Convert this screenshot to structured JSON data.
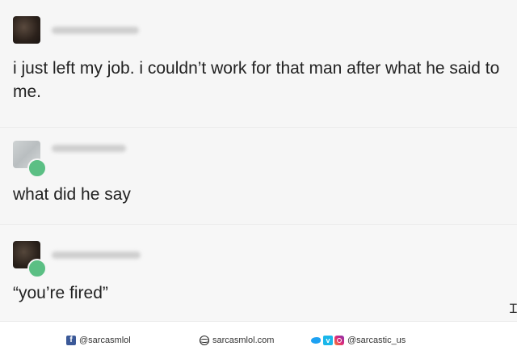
{
  "posts": [
    {
      "text": "i just left my job. i couldn’t work for that man after what he said to me."
    },
    {
      "text": "what did he say"
    },
    {
      "text": "“you’re fired”"
    }
  ],
  "footer": {
    "facebook_handle": "@sarcasmlol",
    "website": "sarcasmlol.com",
    "social_handle": "@sarcastic_us"
  },
  "icons": {
    "facebook": "facebook-icon",
    "website": "dribbble-icon",
    "twitter": "twitter-icon",
    "vimeo": "vimeo-icon",
    "instagram": "instagram-icon"
  },
  "colors": {
    "post_background": "#f6f6f6",
    "badge": "#5bbf84",
    "text": "#222222"
  }
}
